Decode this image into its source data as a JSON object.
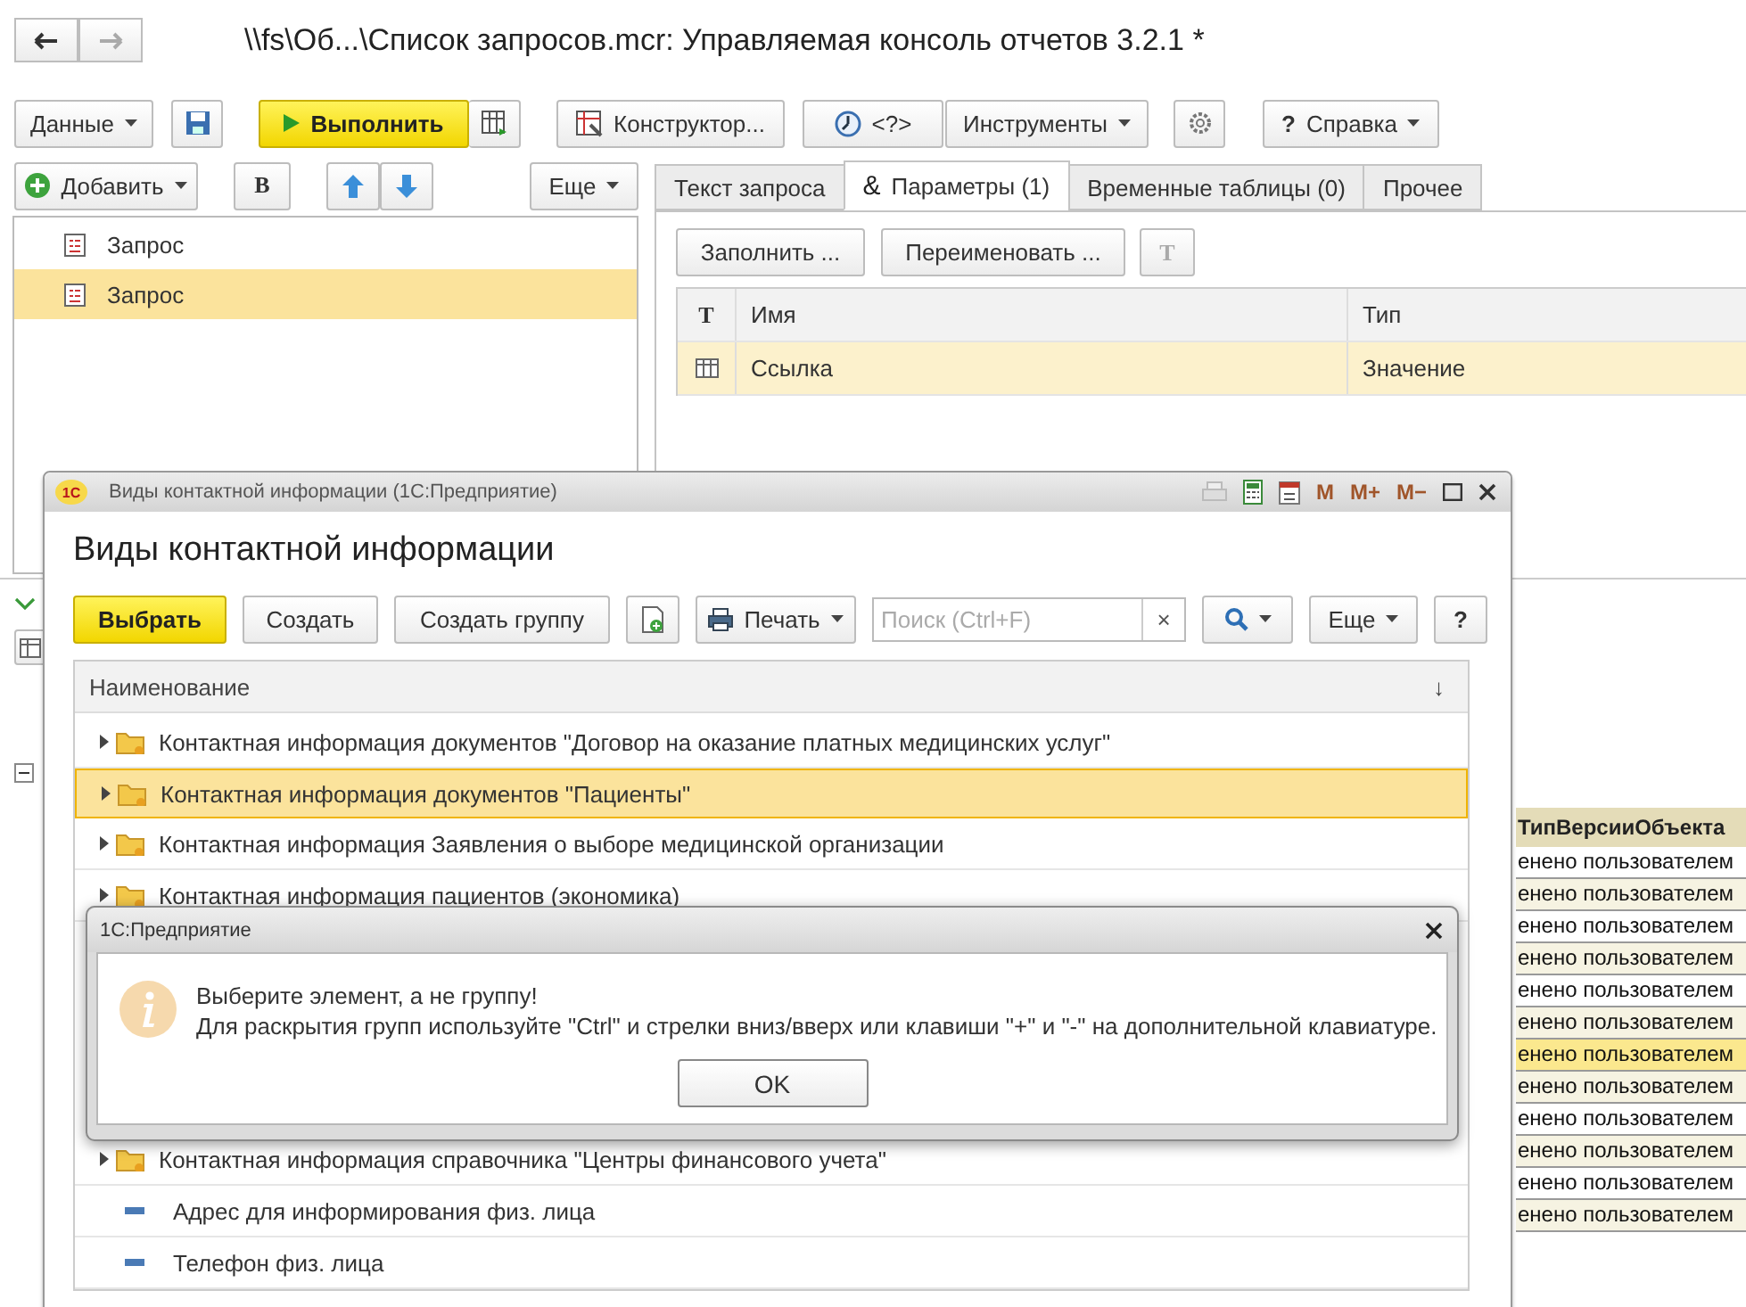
{
  "window": {
    "title": "\\\\fs\\Об...\\Список запросов.mcr: Управляемая консоль отчетов 3.2.1 *"
  },
  "toolbar": {
    "data_button": "Данные",
    "run_button": "Выполнить",
    "constructor_button": "Конструктор...",
    "query_button": "<?>",
    "tools_button": "Инструменты",
    "help_mark": "?",
    "help_button": "Справка"
  },
  "queries_panel": {
    "add_button": "Добавить",
    "bold_button": "B",
    "more_button": "Еще",
    "items": [
      {
        "label": "Запрос",
        "selected": false
      },
      {
        "label": "Запрос",
        "selected": true
      }
    ]
  },
  "tabs": [
    {
      "label": "Текст запроса",
      "selected": false
    },
    {
      "label": "Параметры (1)",
      "prefix": "&",
      "selected": true
    },
    {
      "label": "Временные таблицы (0)",
      "selected": false
    },
    {
      "label": "Прочее",
      "selected": false
    }
  ],
  "parameters": {
    "fill_button": "Заполнить ...",
    "rename_button": "Переименовать ...",
    "type_button": "T",
    "columns": [
      "T",
      "Имя",
      "Тип"
    ],
    "rows": [
      {
        "name": "Ссылка",
        "type": "Значение",
        "selected": true
      }
    ]
  },
  "background_table": {
    "header": "ТипВерсииОбъекта",
    "rows": [
      {
        "value": "енено пользователем",
        "selected": false
      },
      {
        "value": "енено пользователем",
        "selected": false
      },
      {
        "value": "енено пользователем",
        "selected": false
      },
      {
        "value": "енено пользователем",
        "selected": false
      },
      {
        "value": "енено пользователем",
        "selected": false
      },
      {
        "value": "енено пользователем",
        "selected": false
      },
      {
        "value": "енено пользователем",
        "selected": true
      },
      {
        "value": "енено пользователем",
        "selected": false
      },
      {
        "value": "енено пользователем",
        "selected": false
      },
      {
        "value": "енено пользователем",
        "selected": false
      },
      {
        "value": "енено пользователем",
        "selected": false
      },
      {
        "value": "енено пользователем",
        "selected": false
      }
    ]
  },
  "dialog": {
    "logo": "1С",
    "title": "Виды контактной информации  (1С:Предприятие)",
    "memory_buttons": [
      "M",
      "M+",
      "M−"
    ],
    "heading": "Виды контактной информации",
    "select_button": "Выбрать",
    "create_button": "Создать",
    "create_group_button": "Создать группу",
    "print_button": "Печать",
    "search": {
      "placeholder": "Поиск (Ctrl+F)",
      "clear": "×"
    },
    "more_button": "Еще",
    "help_button": "?",
    "column": "Наименование",
    "sort_mark": "↓",
    "rows_top": [
      {
        "kind": "group",
        "label": "Контактная информация документов \"Договор на оказание платных медицинских услуг\"",
        "selected": false
      },
      {
        "kind": "group",
        "label": "Контактная информация документов \"Пациенты\"",
        "selected": true
      },
      {
        "kind": "group",
        "label": "Контактная информация Заявления о выборе медицинской организации",
        "selected": false
      },
      {
        "kind": "group",
        "label": "Контактная информация пациентов (экономика)",
        "selected": false
      }
    ],
    "rows_bottom": [
      {
        "kind": "group",
        "label": "Контактная информация справочника \"Центры финансового учета\"",
        "selected": false
      },
      {
        "kind": "item",
        "label": "Адрес для информирования физ. лица",
        "selected": false
      },
      {
        "kind": "item",
        "label": "Телефон физ. лица",
        "selected": false
      }
    ]
  },
  "message": {
    "title": "1С:Предприятие",
    "lines": [
      "Выберите элемент, а не группу!",
      "Для раскрытия групп используйте \"Ctrl\" и стрелки вниз/вверх или клавиши \"+\" и \"-\" на дополнительной клавиатуре."
    ],
    "ok_button": "OK"
  }
}
